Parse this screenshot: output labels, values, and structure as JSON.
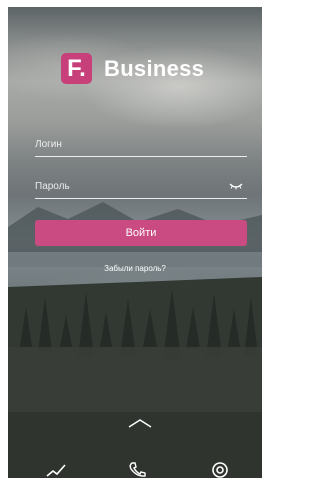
{
  "brand": {
    "logo_letter": "F.",
    "name": "Business"
  },
  "login_form": {
    "login_placeholder": "Логин",
    "password_placeholder": "Пароль",
    "submit_label": "Войти",
    "forgot_password_label": "Забыли пароль?"
  },
  "icons": {
    "show_password": "eye-closed-icon",
    "expand": "chevron-up-icon",
    "bottom_bar": [
      "chart-icon",
      "phone-icon",
      "location-pin-icon"
    ]
  },
  "colors": {
    "accent": "#c94b81",
    "logo_bg": "#c7407a",
    "text": "#ffffff"
  }
}
